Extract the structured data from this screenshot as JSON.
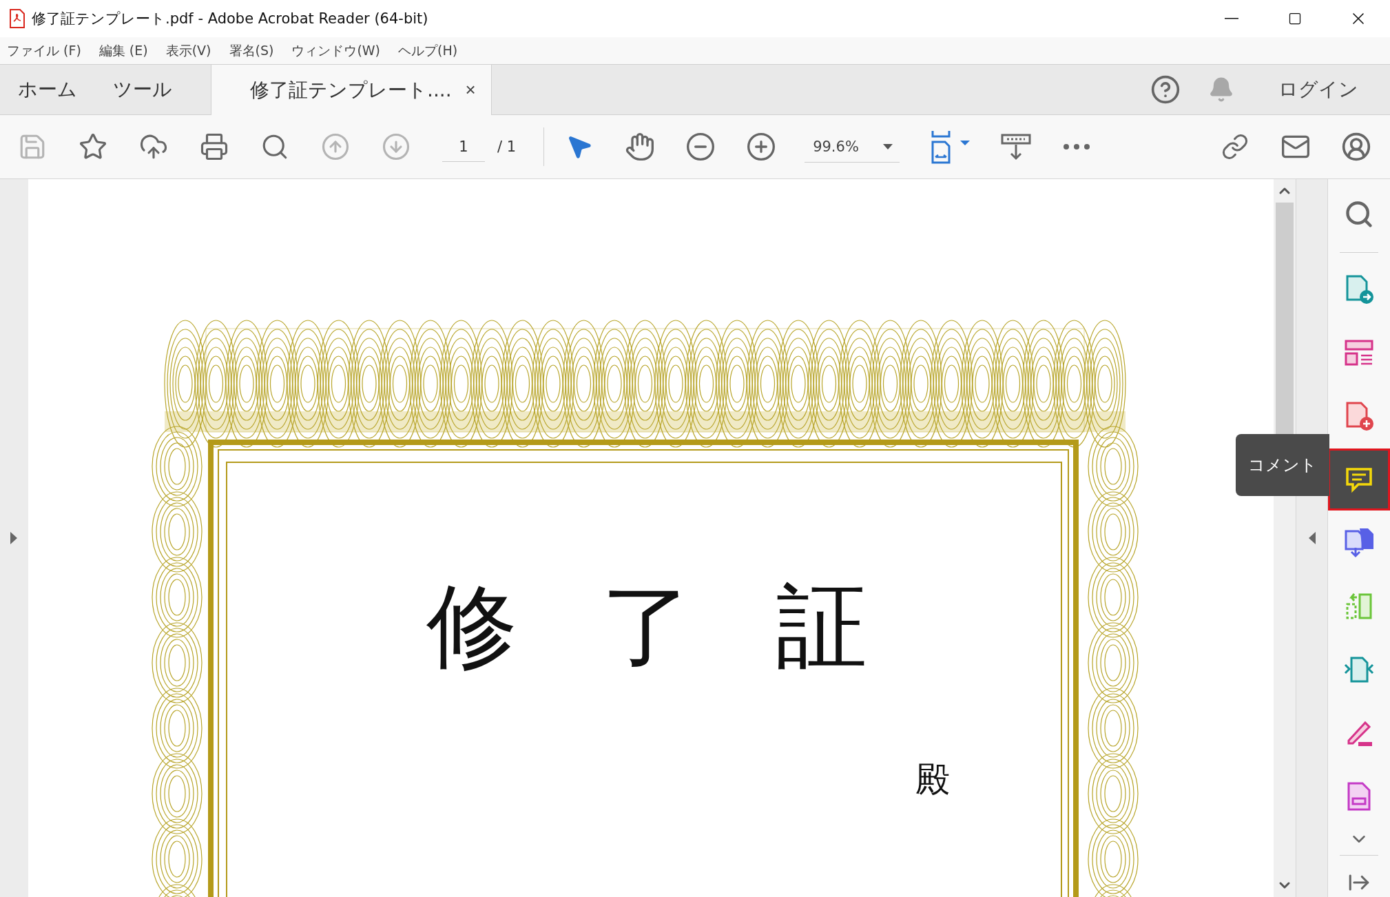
{
  "window": {
    "title": "修了証テンプレート.pdf - Adobe Acrobat Reader (64-bit)"
  },
  "menu": [
    "ファイル (F)",
    "編集 (E)",
    "表示(V)",
    "署名(S)",
    "ウィンドウ(W)",
    "ヘルプ(H)"
  ],
  "tabs": [
    {
      "label": "ホーム",
      "selected": false
    },
    {
      "label": "ツール",
      "selected": false
    },
    {
      "label": "修了証テンプレート....",
      "selected": true,
      "close": "×"
    }
  ],
  "header": {
    "login": "ログイン"
  },
  "toolbar": {
    "tools_left": [
      {
        "kind": "save",
        "disabled": true
      },
      {
        "kind": "star",
        "disabled": false
      },
      {
        "kind": "upload",
        "disabled": false
      },
      {
        "kind": "print",
        "disabled": false
      },
      {
        "kind": "search",
        "disabled": false
      },
      {
        "kind": "up",
        "disabled": true
      },
      {
        "kind": "down",
        "disabled": true
      }
    ],
    "page": "1",
    "page_total": "/ 1",
    "zoom": "99.6%"
  },
  "document": {
    "title": "修 了 証",
    "honorific": "殿"
  },
  "right_pane": {
    "tools": [
      {
        "kind": "export",
        "selected": false
      },
      {
        "kind": "organize",
        "selected": false
      },
      {
        "kind": "create",
        "selected": false
      },
      {
        "kind": "comment",
        "selected": true
      },
      {
        "kind": "combine",
        "selected": false
      },
      {
        "kind": "pages",
        "selected": false
      },
      {
        "kind": "compress",
        "selected": false
      },
      {
        "kind": "fill",
        "selected": false
      },
      {
        "kind": "form",
        "selected": false
      }
    ],
    "tooltip": "コメント"
  }
}
